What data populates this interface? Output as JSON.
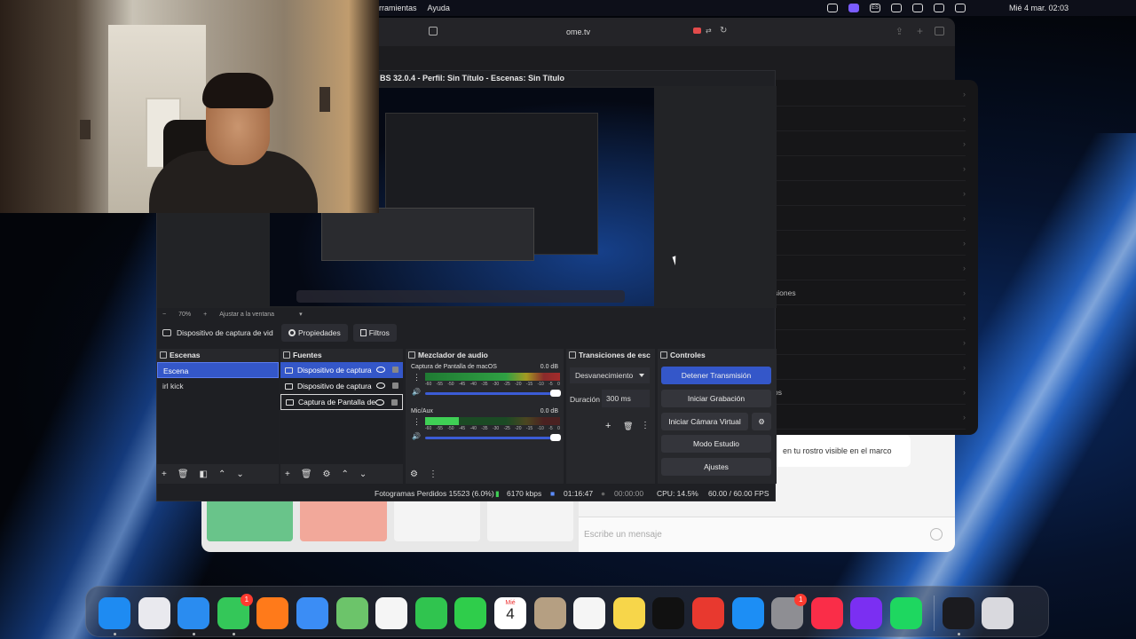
{
  "menubar": {
    "menus": [
      "rramientas",
      "Ayuda"
    ],
    "clock": "Mié 4 mar.  02:03",
    "keyboard_layout": "ES"
  },
  "browser": {
    "address": "ome.tv",
    "chat_text_line1": "en tu rostro visible en el marco",
    "chat_placeholder": "Escribe un mensaje",
    "side_rows": [
      "",
      "",
      "",
      "",
      "",
      "",
      "",
      "",
      "siones",
      "",
      "",
      "",
      "os",
      ""
    ]
  },
  "obs": {
    "title": "BS 32.0.4 - Perfil: Sin Título - Escenas: Sin Título",
    "zoom": {
      "minus": "−",
      "value": "70%",
      "plus": "+",
      "fit_label": "Ajustar a la ventana"
    },
    "source_toolbar": {
      "source_name": "Dispositivo de captura de vid",
      "properties_label": "Propiedades",
      "filters_label": "Filtros"
    },
    "scenes": {
      "header": "Escenas",
      "items": [
        "Escena",
        "irl kick"
      ]
    },
    "sources": {
      "header": "Fuentes",
      "items": [
        "Dispositivo de captura",
        "Dispositivo de captura",
        "Captura de Pantalla de"
      ]
    },
    "mixer": {
      "header": "Mezclador de audio",
      "tracks": [
        {
          "name": "Captura de Pantalla de macOS",
          "db": "0.0 dB"
        },
        {
          "name": "Mic/Aux",
          "db": "0.0 dB"
        }
      ],
      "scale": [
        "-60",
        "-55",
        "-50",
        "-45",
        "-40",
        "-35",
        "-30",
        "-25",
        "-20",
        "-15",
        "-10",
        "-5",
        "0"
      ]
    },
    "transitions": {
      "header": "Transiciones de esc",
      "selected": "Desvanecimiento",
      "duration_label": "Duración",
      "duration_value": "300 ms"
    },
    "controls": {
      "header": "Controles",
      "stop_stream": "Detener Transmisión",
      "start_recording": "Iniciar Grabación",
      "start_virtual_cam": "Iniciar Cámara Virtual",
      "studio_mode": "Modo Estudio",
      "settings": "Ajustes"
    },
    "status": {
      "dropped_frames": "Fotogramas Perdidos 15523 (6.0%)",
      "bitrate": "6170 kbps",
      "stream_time": "01:16:47",
      "record_time": "00:00:00",
      "cpu": "CPU: 14.5%",
      "fps": "60.00 / 60.00 FPS"
    }
  },
  "dock": {
    "calendar_month": "Mié",
    "calendar_day": "4",
    "messages_badge": "1",
    "settings_badge": "1",
    "apps": [
      {
        "name": "finder-icon",
        "color": "#1e8bf2"
      },
      {
        "name": "launchpad-icon",
        "color": "#e9e9ee"
      },
      {
        "name": "safari-icon",
        "color": "#2a8cf0"
      },
      {
        "name": "messages-icon",
        "color": "#34c759"
      },
      {
        "name": "firefox-icon",
        "color": "#ff7a1a"
      },
      {
        "name": "mail-icon",
        "color": "#3b8df5"
      },
      {
        "name": "maps-icon",
        "color": "#6cc46a"
      },
      {
        "name": "photos-icon",
        "color": "#f5f5f5"
      },
      {
        "name": "facetime-icon",
        "color": "#30c44f"
      },
      {
        "name": "phone-icon",
        "color": "#2fcd4b"
      },
      {
        "name": "calendar-icon",
        "color": "#ffffff"
      },
      {
        "name": "contacts-icon",
        "color": "#b59f82"
      },
      {
        "name": "reminders-icon",
        "color": "#f5f5f5"
      },
      {
        "name": "notes-icon",
        "color": "#f7d64a"
      },
      {
        "name": "apple-tv-icon",
        "color": "#111111"
      },
      {
        "name": "rocket-typist-icon",
        "color": "#e8392f"
      },
      {
        "name": "app-store-icon",
        "color": "#1c8ef5"
      },
      {
        "name": "system-settings-icon",
        "color": "#8e8e93"
      },
      {
        "name": "music-icon",
        "color": "#fa2d48"
      },
      {
        "name": "clapper-icon",
        "color": "#7b2ff2"
      },
      {
        "name": "spotify-icon",
        "color": "#1ed760"
      },
      {
        "name": "obs-icon",
        "color": "#1b1b1f"
      },
      {
        "name": "trash-icon",
        "color": "#d9d9de"
      }
    ]
  }
}
